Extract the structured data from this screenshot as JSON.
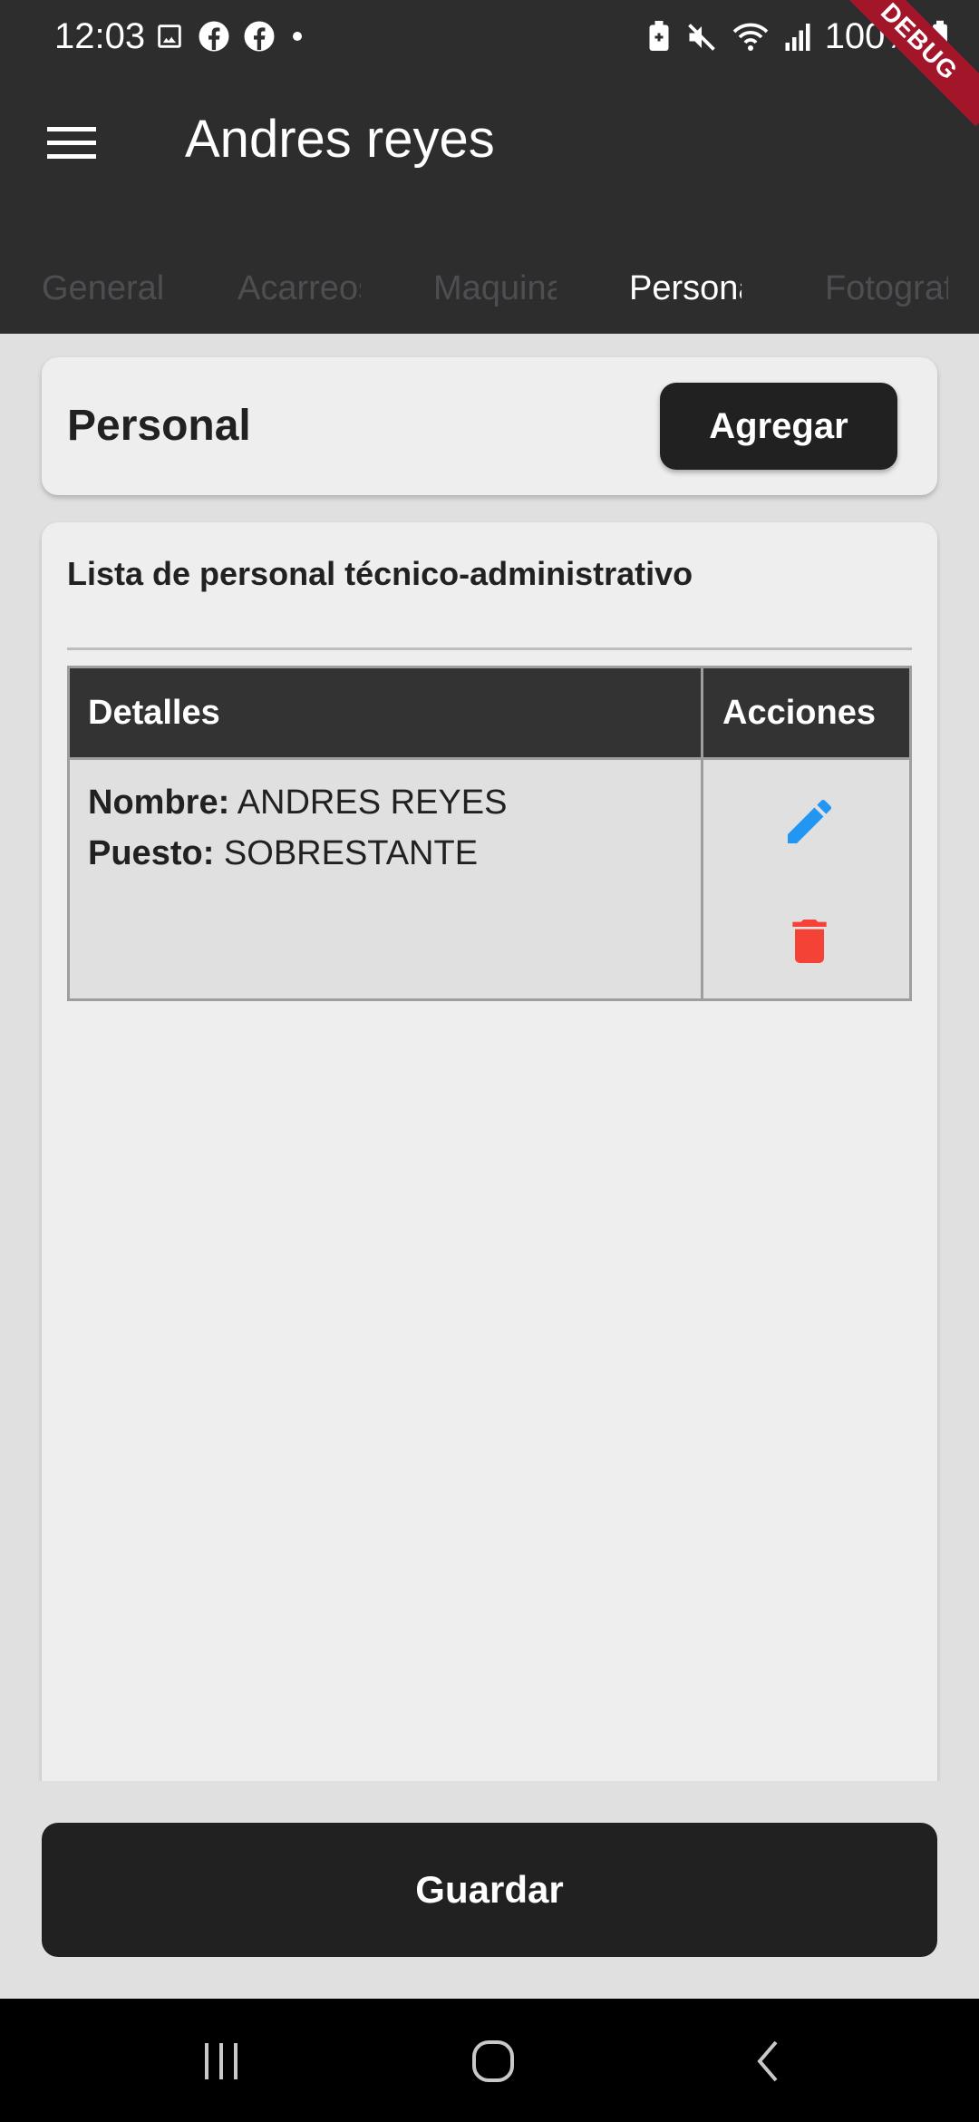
{
  "status_bar": {
    "time": "12:03",
    "battery": "100%",
    "left_icons": [
      "image-icon",
      "facebook-icon",
      "facebook-icon",
      "dot-icon"
    ],
    "right_icons": [
      "battery-saver-icon",
      "mute-icon",
      "wifi-icon",
      "signal-icon",
      "battery-icon"
    ]
  },
  "app_bar": {
    "title": "Andres reyes",
    "menu_icon": "hamburger-menu-icon"
  },
  "debug_banner": "DEBUG",
  "tabs": [
    {
      "label": "General",
      "active": false
    },
    {
      "label": "Acarreos",
      "active": false
    },
    {
      "label": "Maquinaria",
      "active": false
    },
    {
      "label": "Personal",
      "active": true
    },
    {
      "label": "Fotografías",
      "active": false
    }
  ],
  "header_card": {
    "title": "Personal",
    "add_button": "Agregar"
  },
  "list_card": {
    "title": "Lista de personal técnico-administrativo",
    "table": {
      "headers": [
        "Detalles",
        "Acciones"
      ],
      "rows": [
        {
          "nombre_label": "Nombre:",
          "nombre": "ANDRES REYES",
          "puesto_label": "Puesto:",
          "puesto": "SOBRESTANTE",
          "actions": [
            "edit-icon",
            "delete-icon"
          ]
        }
      ]
    }
  },
  "save_button": "Guardar",
  "colors": {
    "app_bar": "#2d2d2d",
    "edit_icon": "#2196f3",
    "delete_icon": "#f44336",
    "button": "#212121",
    "debug_banner": "#a3162a"
  },
  "nav_bar": [
    "recents-icon",
    "home-icon",
    "back-icon"
  ]
}
